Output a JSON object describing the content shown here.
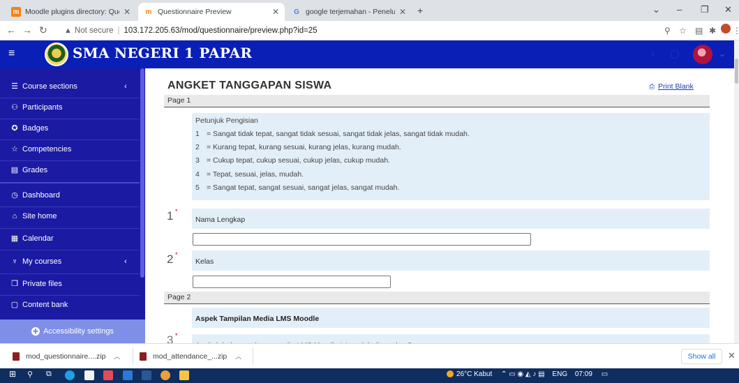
{
  "browser": {
    "tabs": [
      {
        "favicon": "m",
        "title": "Moodle plugins directory: Questi",
        "active": false
      },
      {
        "favicon": "m",
        "title": "Questionnaire Preview",
        "active": true
      },
      {
        "favicon": "G",
        "title": "google terjemahan - Penelusuran",
        "active": false
      }
    ],
    "new_tab": "+",
    "security_label": "Not secure",
    "url": "103.172.205.63/mod/questionnaire/preview.php?id=25"
  },
  "navbar": {
    "site_name": "SMA NEGERI 1 PAPAR"
  },
  "sidebar": {
    "items": [
      {
        "icon": "list-icon",
        "glyph": "☰",
        "label": "Course sections",
        "chevron": "‹"
      },
      {
        "icon": "users-icon",
        "glyph": "⚇",
        "label": "Participants"
      },
      {
        "icon": "badge-icon",
        "glyph": "✪",
        "label": "Badges"
      },
      {
        "icon": "star-icon",
        "glyph": "☆",
        "label": "Competencies"
      },
      {
        "icon": "grades-icon",
        "glyph": "▤",
        "label": "Grades"
      },
      {
        "icon": "dashboard-icon",
        "glyph": "◷",
        "label": "Dashboard"
      },
      {
        "icon": "home-icon",
        "glyph": "⌂",
        "label": "Site home"
      },
      {
        "icon": "calendar-icon",
        "glyph": "▦",
        "label": "Calendar"
      },
      {
        "icon": "courses-icon",
        "glyph": "♆",
        "label": "My courses",
        "chevron": "‹"
      },
      {
        "icon": "files-icon",
        "glyph": "❐",
        "label": "Private files"
      },
      {
        "icon": "content-bank-icon",
        "glyph": "▢",
        "label": "Content bank"
      }
    ],
    "accessibility_label": "Accessibility settings"
  },
  "main": {
    "title": "ANGKET TANGGAPAN SISWA",
    "print_label": "Print Blank",
    "page1_label": "Page 1",
    "instructions": {
      "heading": "Petunjuk Pengisian",
      "lines": [
        {
          "num": "1",
          "text": "= Sangat tidak tepat, sangat tidak sesuai, sangat tidak jelas, sangat tidak mudah."
        },
        {
          "num": "2",
          "text": "= Kurang tepat, kurang sesuai, kurang jelas, kurang mudah."
        },
        {
          "num": "3",
          "text": "= Cukup tepat, cukup sesuai, cukup jelas, cukup mudah."
        },
        {
          "num": "4",
          "text": "= Tepat, sesuai, jelas, mudah."
        },
        {
          "num": "5",
          "text": "= Sangat tepat, sangat sesuai, sangat jelas, sangat mudah."
        }
      ]
    },
    "questions": [
      {
        "num": "1",
        "required": "*",
        "label": "Nama Lengkap",
        "value": ""
      },
      {
        "num": "2",
        "required": "*",
        "label": "Kelas",
        "value": ""
      }
    ],
    "page2_label": "Page 2",
    "section2_heading": "Aspek Tampilan Media LMS Moodle",
    "q3": {
      "num": "3",
      "required": "*",
      "label": "Apakah halaman depan media LMS Moodle ini mudah digunakan?"
    }
  },
  "downloads": {
    "items": [
      "mod_questionnaire....zip",
      "mod_attendance_...zip"
    ],
    "show_all": "Show all"
  },
  "taskbar": {
    "weather": "26°C Kabut",
    "lang": "ENG",
    "time": "07:09"
  }
}
